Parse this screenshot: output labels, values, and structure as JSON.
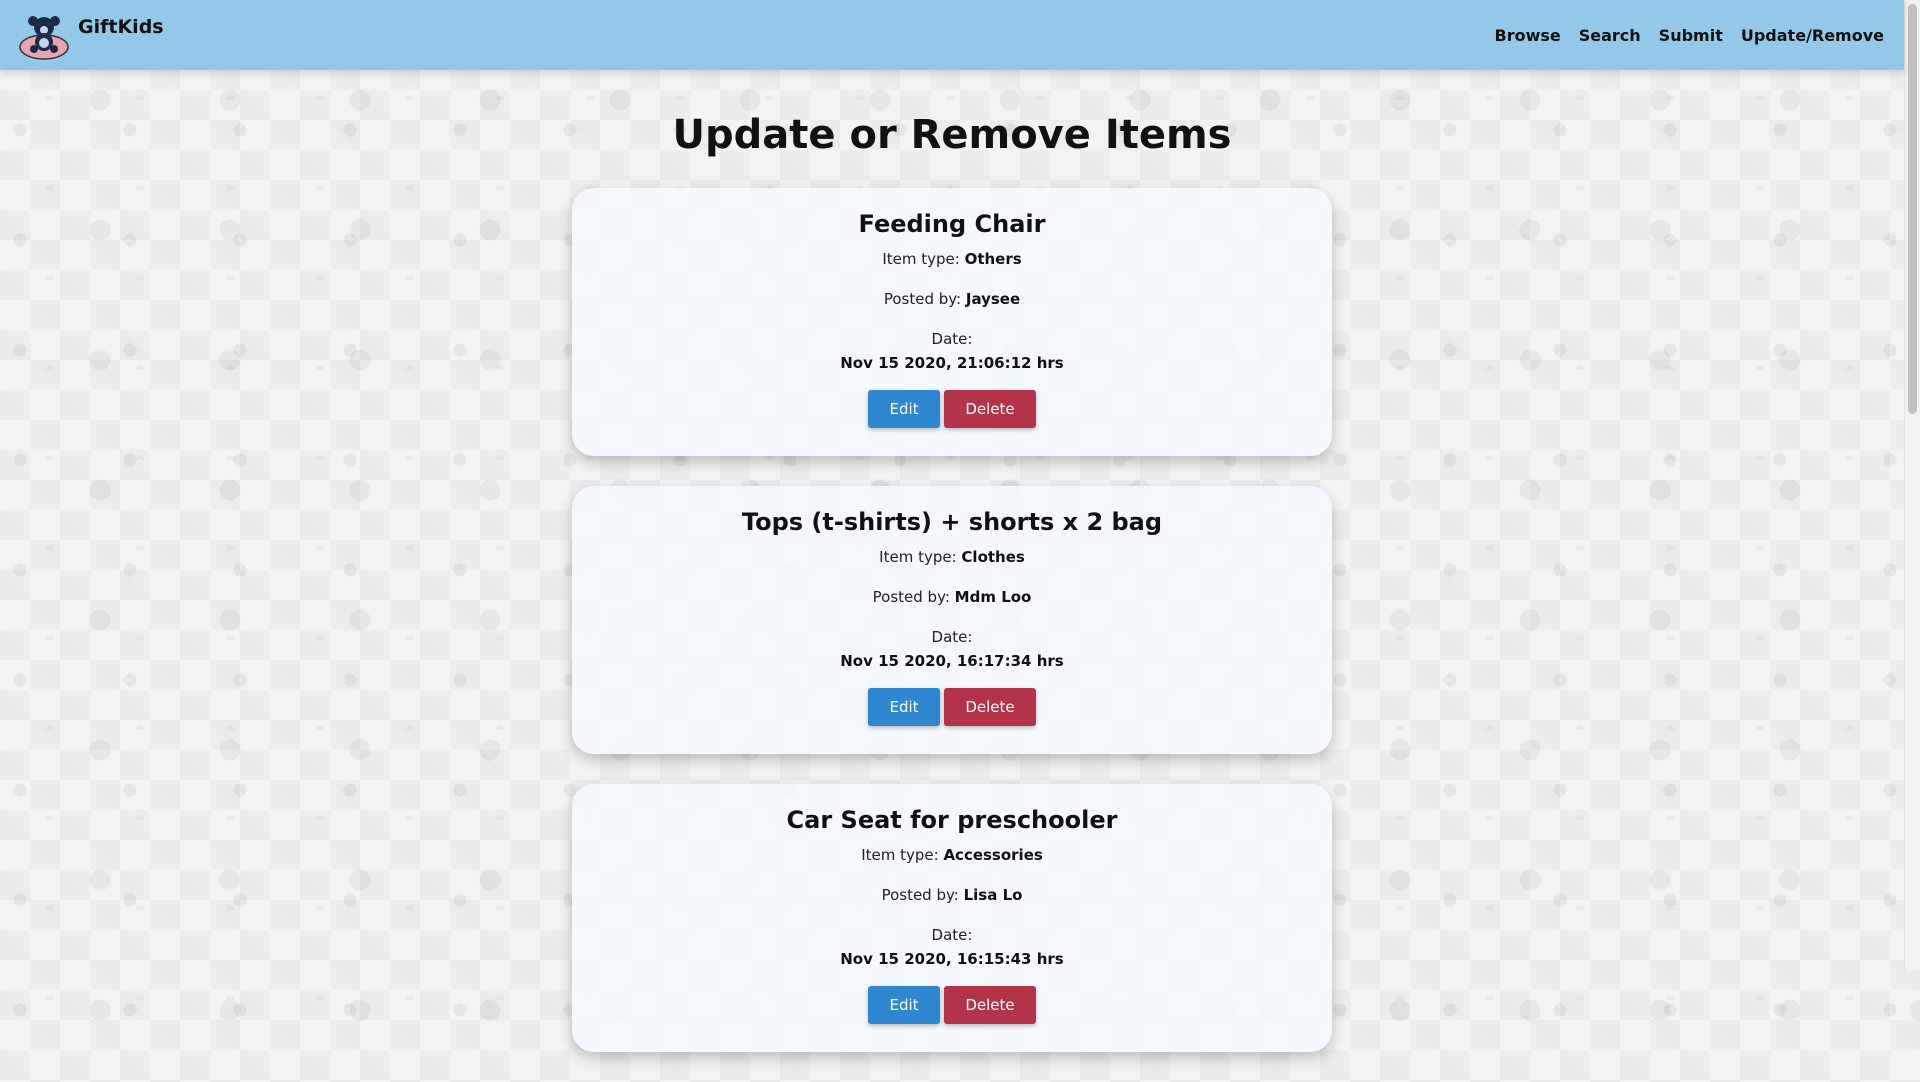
{
  "brand": {
    "name": "GiftKids"
  },
  "nav": {
    "items": [
      "Browse",
      "Search",
      "Submit",
      "Update/Remove"
    ]
  },
  "page": {
    "title": "Update or Remove Items"
  },
  "labels": {
    "item_type": "Item type: ",
    "posted_by": "Posted by: ",
    "date": "Date:",
    "edit": "Edit",
    "delete": "Delete"
  },
  "items": [
    {
      "title": "Feeding Chair",
      "type": "Others",
      "posted_by": "Jaysee",
      "date": "Nov 15 2020, 21:06:12 hrs"
    },
    {
      "title": "Tops (t-shirts) + shorts x 2 bag",
      "type": "Clothes",
      "posted_by": "Mdm Loo",
      "date": "Nov 15 2020, 16:17:34 hrs"
    },
    {
      "title": "Car Seat for preschooler",
      "type": "Accessories",
      "posted_by": "Lisa Lo",
      "date": "Nov 15 2020, 16:15:43 hrs"
    }
  ],
  "colors": {
    "navbar": "#93c8e8",
    "edit_button": "#2f86d1",
    "delete_button": "#b3334a"
  },
  "icons": {
    "logo": "teddy-bear-logo-icon"
  }
}
